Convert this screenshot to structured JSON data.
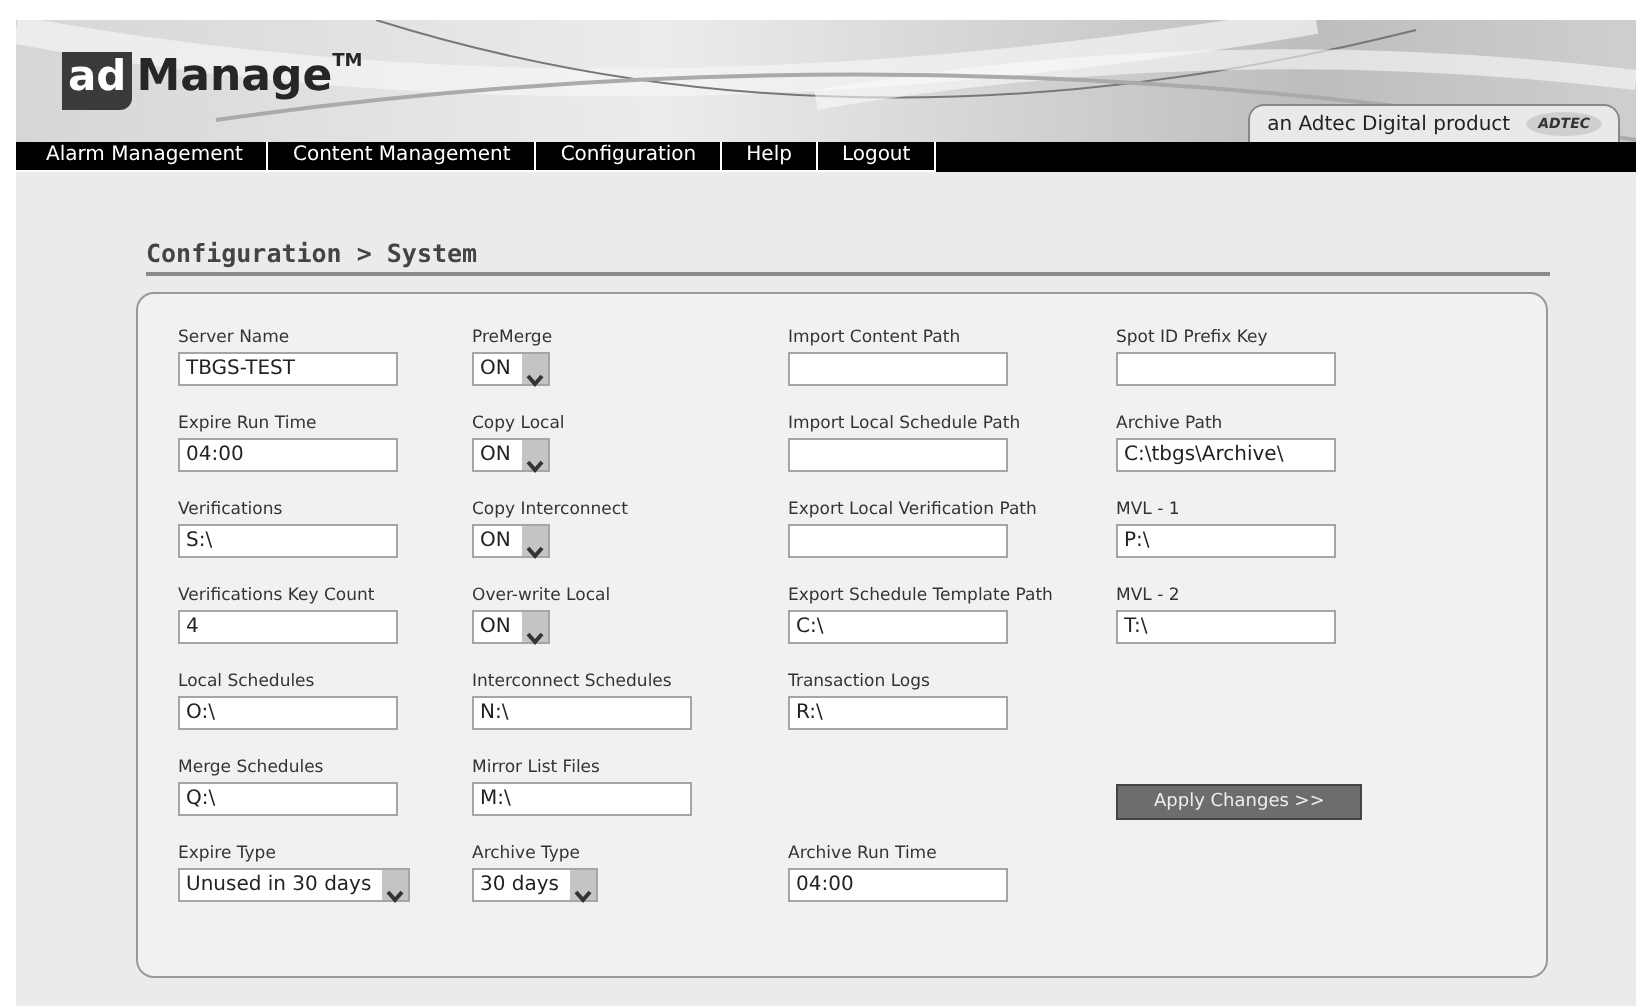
{
  "header": {
    "logo": {
      "badge": "ad",
      "name": "Manage",
      "mark": "TM"
    },
    "product_tag": {
      "text": "an Adtec Digital product",
      "brand": "ADTEC"
    }
  },
  "nav": [
    {
      "label": "Alarm Management"
    },
    {
      "label": "Content Management"
    },
    {
      "label": "Configuration"
    },
    {
      "label": "Help"
    },
    {
      "label": "Logout"
    }
  ],
  "page_title": "Configuration > System",
  "rows": [
    [
      {
        "kind": "text",
        "label": "Server Name",
        "value": "TBGS-TEST"
      },
      {
        "kind": "select",
        "label": "PreMerge",
        "value": "ON"
      },
      {
        "kind": "text",
        "label": "Import Content Path"
      },
      {
        "kind": "text",
        "label": "Spot ID Prefix Key"
      }
    ],
    [
      {
        "kind": "text",
        "label": "Expire Run Time",
        "value": "04:00"
      },
      {
        "kind": "select",
        "label": "Copy Local",
        "value": "ON"
      },
      {
        "kind": "text",
        "label": "Import Local Schedule Path"
      },
      {
        "kind": "text",
        "label": "Archive Path",
        "value": "C:\\tbgs\\Archive\\"
      }
    ],
    [
      {
        "kind": "text",
        "label": "Verifications",
        "value": "S:\\"
      },
      {
        "kind": "select",
        "label": "Copy Interconnect",
        "value": "ON"
      },
      {
        "kind": "text",
        "label": "Export Local Verification Path"
      },
      {
        "kind": "text",
        "label": "MVL - 1",
        "value": "P:\\"
      }
    ],
    [
      {
        "kind": "text",
        "label": "Verifications Key Count",
        "value": "4"
      },
      {
        "kind": "select",
        "label": "Over-write Local",
        "value": "ON"
      },
      {
        "kind": "text",
        "label": "Export Schedule Template Path",
        "value": "C:\\"
      },
      {
        "kind": "text",
        "label": "MVL - 2",
        "value": "T:\\"
      }
    ],
    [
      {
        "kind": "text",
        "label": "Local Schedules",
        "value": "O:\\"
      },
      {
        "kind": "text",
        "label": "Interconnect Schedules",
        "value": "N:\\"
      },
      {
        "kind": "text",
        "label": "Transaction Logs",
        "value": "R:\\"
      },
      {
        "kind": "empty"
      }
    ],
    [
      {
        "kind": "text",
        "label": "Merge Schedules",
        "value": "Q:\\"
      },
      {
        "kind": "text",
        "label": "Mirror List Files",
        "value": "M:\\"
      },
      {
        "kind": "empty"
      },
      {
        "kind": "button",
        "label": "Apply Changes >>"
      }
    ],
    [
      {
        "kind": "select",
        "label": "Expire Type",
        "value": "Unused in 30 days"
      },
      {
        "kind": "select",
        "label": "Archive Type",
        "value": "30 days"
      },
      {
        "kind": "text",
        "label": "Archive Run Time",
        "value": "04:00"
      },
      {
        "kind": "empty"
      }
    ]
  ]
}
